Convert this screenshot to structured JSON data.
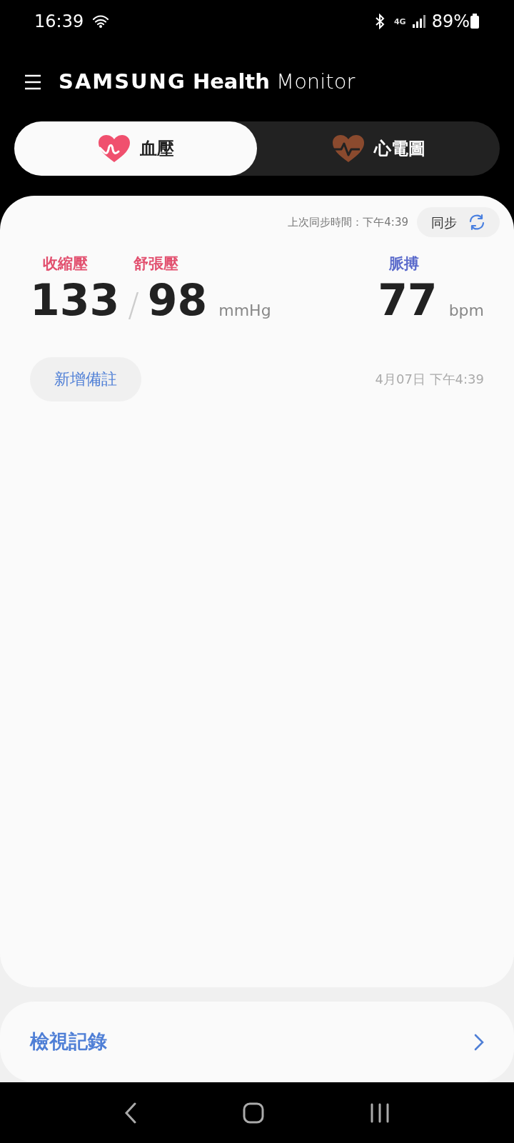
{
  "status_bar": {
    "time": "16:39",
    "network": "4G",
    "battery": "89%"
  },
  "header": {
    "brand": "SAMSUNG",
    "app_bold": "Health",
    "app_light": "Monitor"
  },
  "tabs": [
    {
      "label": "血壓",
      "kind": "bp",
      "selected": true
    },
    {
      "label": "心電圖",
      "kind": "ecg",
      "selected": false
    }
  ],
  "reading": {
    "last_sync": "上次同步時間：下午4:39",
    "sync_button": "同步",
    "systolic_label": "收縮壓",
    "diastolic_label": "舒張壓",
    "pulse_label": "脈搏",
    "systolic": "133",
    "separator": "/",
    "diastolic": "98",
    "pressure_unit": "mmHg",
    "pulse": "77",
    "pulse_unit": "bpm",
    "add_note": "新增備註",
    "timestamp": "4月07日 下午4:39"
  },
  "history_link": "檢視記錄"
}
